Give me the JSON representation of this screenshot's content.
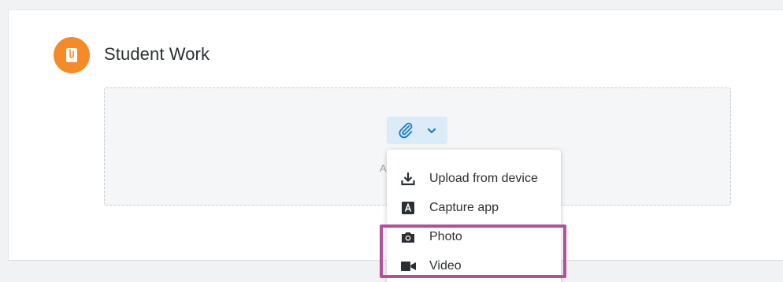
{
  "section": {
    "title": "Student Work",
    "icon": "clip-document-icon",
    "icon_color": "#f58a27"
  },
  "dropzone": {
    "hint_visible_text": "A"
  },
  "attach_button": {
    "icon": "paperclip-icon",
    "dropdown_icon": "chevron-down-icon",
    "accent_color": "#1a7ccf",
    "background": "#dbebf7"
  },
  "menu": {
    "items": [
      {
        "label": "Upload from device",
        "icon": "download-icon"
      },
      {
        "label": "Capture app",
        "icon": "capture-app-icon"
      },
      {
        "label": "Photo",
        "icon": "camera-icon"
      },
      {
        "label": "Video",
        "icon": "video-camera-icon"
      }
    ]
  },
  "highlight": {
    "color": "#b4509b",
    "covers": [
      "Photo",
      "Video"
    ]
  }
}
